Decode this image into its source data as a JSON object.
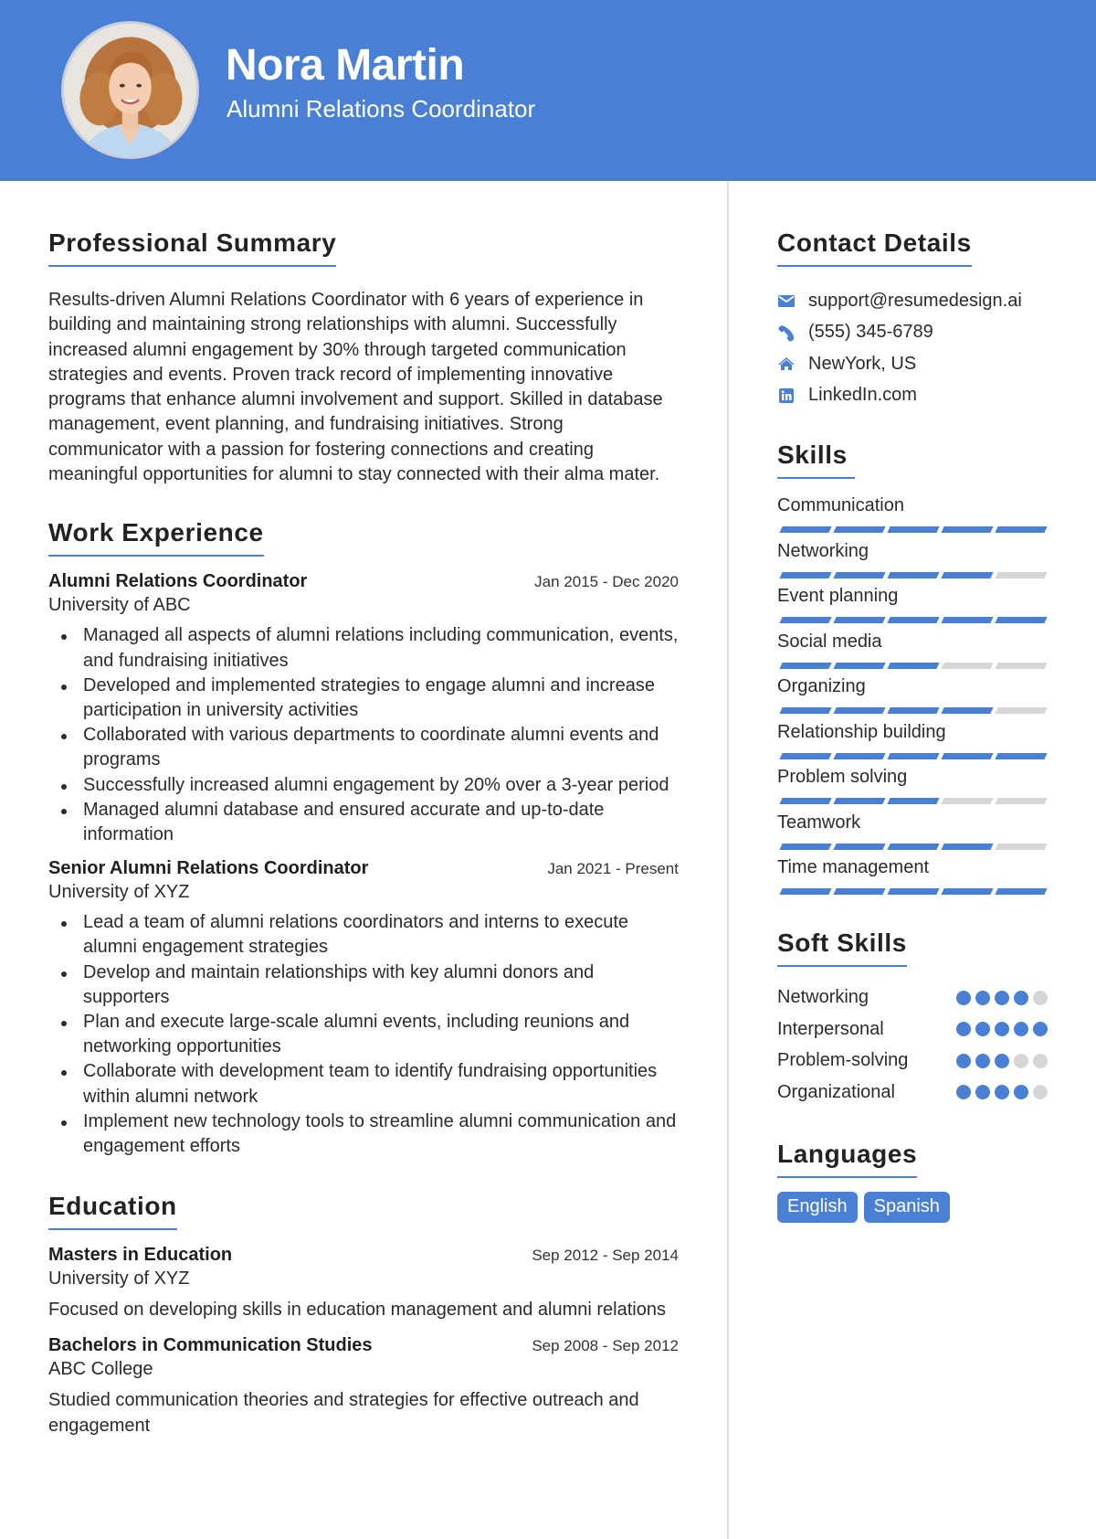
{
  "header": {
    "name": "Nora Martin",
    "role": "Alumni Relations Coordinator",
    "avatar_alt": "profile photo",
    "accent_color": "#4a7fd6"
  },
  "summary": {
    "title": "Professional Summary",
    "text": "Results-driven Alumni Relations Coordinator with 6 years of experience in building and maintaining strong relationships with alumni. Successfully increased alumni engagement by 30% through targeted communication strategies and events. Proven track record of implementing innovative programs that enhance alumni involvement and support. Skilled in database management, event planning, and fundraising initiatives. Strong communicator with a passion for fostering connections and creating meaningful opportunities for alumni to stay connected with their alma mater."
  },
  "experience": {
    "title": "Work Experience",
    "jobs": [
      {
        "title": "Alumni Relations Coordinator",
        "dates": "Jan 2015 - Dec 2020",
        "org": "University of ABC",
        "bullets": [
          "Managed all aspects of alumni relations including communication, events, and fundraising initiatives",
          "Developed and implemented strategies to engage alumni and increase participation in university activities",
          "Collaborated with various departments to coordinate alumni events and programs",
          "Successfully increased alumni engagement by 20% over a 3-year period",
          "Managed alumni database and ensured accurate and up-to-date information"
        ]
      },
      {
        "title": "Senior Alumni Relations Coordinator",
        "dates": "Jan 2021 - Present",
        "org": "University of XYZ",
        "bullets": [
          "Lead a team of alumni relations coordinators and interns to execute alumni engagement strategies",
          "Develop and maintain relationships with key alumni donors and supporters",
          "Plan and execute large-scale alumni events, including reunions and networking opportunities",
          "Collaborate with development team to identify fundraising opportunities within alumni network",
          "Implement new technology tools to streamline alumni communication and engagement efforts"
        ]
      }
    ]
  },
  "education": {
    "title": "Education",
    "items": [
      {
        "degree": "Masters in Education",
        "dates": "Sep 2012 - Sep 2014",
        "school": "University of XYZ",
        "desc": "Focused on developing skills in education management and alumni relations"
      },
      {
        "degree": "Bachelors in Communication Studies",
        "dates": "Sep 2008 - Sep 2012",
        "school": "ABC College",
        "desc": "Studied communication theories and strategies for effective outreach and engagement"
      }
    ]
  },
  "contact": {
    "title": "Contact Details",
    "items": [
      {
        "icon": "envelope-icon",
        "text": "support@resumedesign.ai"
      },
      {
        "icon": "phone-icon",
        "text": "(555) 345-6789"
      },
      {
        "icon": "home-icon",
        "text": "NewYork, US"
      },
      {
        "icon": "linkedin-icon",
        "text": "LinkedIn.com"
      }
    ]
  },
  "skills": {
    "title": "Skills",
    "max": 5,
    "items": [
      {
        "name": "Communication",
        "level": 5
      },
      {
        "name": "Networking",
        "level": 4
      },
      {
        "name": "Event planning",
        "level": 5
      },
      {
        "name": "Social media",
        "level": 3
      },
      {
        "name": "Organizing",
        "level": 4
      },
      {
        "name": "Relationship building",
        "level": 5
      },
      {
        "name": "Problem solving",
        "level": 3
      },
      {
        "name": "Teamwork",
        "level": 4
      },
      {
        "name": "Time management",
        "level": 5
      }
    ]
  },
  "soft_skills": {
    "title": "Soft Skills",
    "max": 5,
    "items": [
      {
        "name": "Networking",
        "level": 4
      },
      {
        "name": "Interpersonal",
        "level": 5
      },
      {
        "name": "Problem-solving",
        "level": 3
      },
      {
        "name": "Organizational",
        "level": 4
      }
    ]
  },
  "languages": {
    "title": "Languages",
    "items": [
      "English",
      "Spanish"
    ]
  }
}
